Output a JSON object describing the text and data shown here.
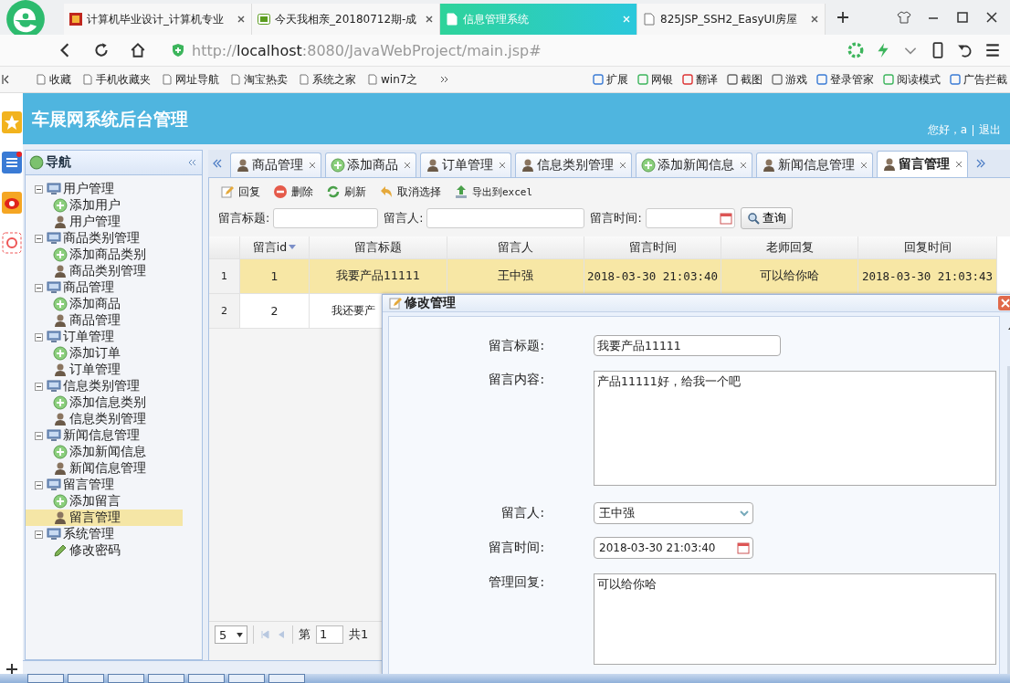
{
  "browser": {
    "tabs": [
      {
        "label": "计算机毕业设计_计算机专业",
        "selected": false,
        "kind": "red"
      },
      {
        "label": "今天我相亲_20180712期-成",
        "selected": false,
        "kind": "video"
      },
      {
        "label": "信息管理系统",
        "selected": true,
        "kind": "page"
      },
      {
        "label": "825JSP_SSH2_EasyUI房屋",
        "selected": false,
        "kind": "page"
      }
    ],
    "url": "http://**localhost**:8080/JavaWebProject/main.jsp#",
    "bookmarks": [
      "收藏",
      "手机收藏夹",
      "网址导航",
      "淘宝热卖",
      "系统之家",
      "win7之"
    ],
    "tools": [
      "扩展",
      "网银",
      "翻译",
      "截图",
      "游戏",
      "登录管家",
      "阅读模式",
      "广告拦截"
    ]
  },
  "app": {
    "title": "车展网系统后台管理",
    "greeting": "您好，a",
    "logout": "退出"
  },
  "nav": {
    "title": "导航",
    "groups": [
      {
        "label": "用户管理",
        "expanded": true,
        "children": [
          {
            "label": "添加用户",
            "kind": "add",
            "selected": false
          },
          {
            "label": "用户管理",
            "kind": "user",
            "selected": false
          }
        ]
      },
      {
        "label": "商品类别管理",
        "expanded": true,
        "children": [
          {
            "label": "添加商品类别",
            "kind": "add",
            "selected": false
          },
          {
            "label": "商品类别管理",
            "kind": "user",
            "selected": false
          }
        ]
      },
      {
        "label": "商品管理",
        "expanded": true,
        "children": [
          {
            "label": "添加商品",
            "kind": "add",
            "selected": false
          },
          {
            "label": "商品管理",
            "kind": "user",
            "selected": false
          }
        ]
      },
      {
        "label": "订单管理",
        "expanded": true,
        "children": [
          {
            "label": "添加订单",
            "kind": "add",
            "selected": false
          },
          {
            "label": "订单管理",
            "kind": "user",
            "selected": false
          }
        ]
      },
      {
        "label": "信息类别管理",
        "expanded": true,
        "children": [
          {
            "label": "添加信息类别",
            "kind": "add",
            "selected": false
          },
          {
            "label": "信息类别管理",
            "kind": "user",
            "selected": false
          }
        ]
      },
      {
        "label": "新闻信息管理",
        "expanded": true,
        "children": [
          {
            "label": "添加新闻信息",
            "kind": "add",
            "selected": false
          },
          {
            "label": "新闻信息管理",
            "kind": "user",
            "selected": false
          }
        ]
      },
      {
        "label": "留言管理",
        "expanded": true,
        "children": [
          {
            "label": "添加留言",
            "kind": "add",
            "selected": false
          },
          {
            "label": "留言管理",
            "kind": "user",
            "selected": true
          }
        ]
      },
      {
        "label": "系统管理",
        "expanded": true,
        "children": [
          {
            "label": "修改密码",
            "kind": "pencil",
            "selected": false
          }
        ]
      }
    ]
  },
  "tabs": [
    {
      "label": "商品管理",
      "kind": "user",
      "selected": false
    },
    {
      "label": "添加商品",
      "kind": "add",
      "selected": false
    },
    {
      "label": "订单管理",
      "kind": "user",
      "selected": false
    },
    {
      "label": "信息类别管理",
      "kind": "user",
      "selected": false
    },
    {
      "label": "添加新闻信息",
      "kind": "add",
      "selected": false
    },
    {
      "label": "新闻信息管理",
      "kind": "user",
      "selected": false
    },
    {
      "label": "留言管理",
      "kind": "user",
      "selected": true
    }
  ],
  "toolbar": [
    {
      "label": "回复",
      "kind": "edit"
    },
    {
      "label": "删除",
      "kind": "delete"
    },
    {
      "label": "刷新",
      "kind": "refresh"
    },
    {
      "label": "取消选择",
      "kind": "undo"
    },
    {
      "label": "导出到excel",
      "kind": "export"
    }
  ],
  "search": {
    "fields": [
      {
        "label": "留言标题:",
        "kind": "text"
      },
      {
        "label": "留言人:",
        "kind": "text"
      },
      {
        "label": "留言时间:",
        "kind": "date"
      }
    ],
    "button": "查询"
  },
  "table": {
    "columns": [
      {
        "sorted": false
      },
      {
        "label": "留言id",
        "sorted": true
      },
      {
        "label": "留言标题",
        "sorted": false
      },
      {
        "label": "留言人",
        "sorted": false
      },
      {
        "label": "留言时间",
        "sorted": false
      },
      {
        "label": "老师回复",
        "sorted": false
      },
      {
        "label": "回复时间",
        "sorted": false
      }
    ],
    "rows": [
      {
        "selected": true,
        "cells": [
          "1",
          "1",
          "我要产品11111",
          "王中强",
          "2018-03-30 21:03:40",
          "可以给你哈",
          "2018-03-30 21:03:43"
        ]
      },
      {
        "selected": false,
        "cells": [
          "2",
          "2",
          "我还要产"
        ]
      }
    ]
  },
  "pager": {
    "page_size": "5",
    "page_prefix": "第",
    "page": "1",
    "total": "共1"
  },
  "dialog": {
    "title": "修改管理",
    "fields": [
      {
        "label": "留言标题:",
        "kind": "text",
        "value": "我要产品11111"
      },
      {
        "label": "留言内容:",
        "kind": "textarea",
        "value": "产品11111好，给我一个吧"
      },
      {
        "label": "留言人:",
        "kind": "select",
        "value": "王中强"
      },
      {
        "label": "留言时间:",
        "kind": "date",
        "value": "2018-03-30 21:03:40"
      },
      {
        "label": "管理回复:",
        "kind": "textarea_cut",
        "value": "可以给你哈"
      }
    ]
  }
}
